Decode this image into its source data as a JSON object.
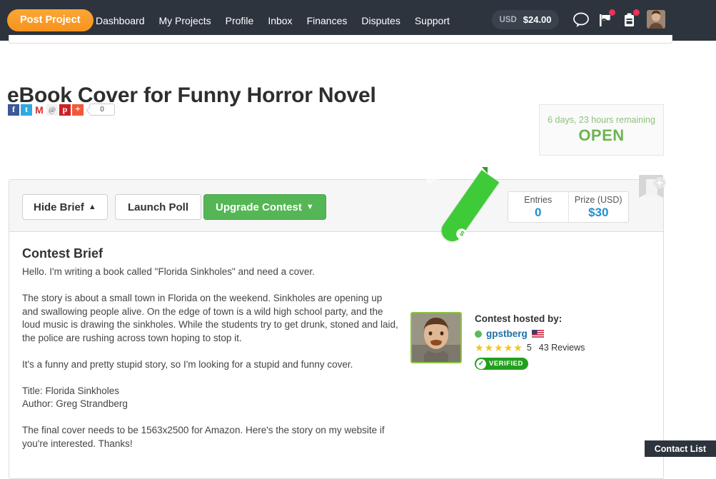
{
  "topnav": {
    "post_project_label": "Post Project",
    "links": [
      {
        "label": "Dashboard"
      },
      {
        "label": "My Projects"
      },
      {
        "label": "Profile"
      },
      {
        "label": "Inbox"
      },
      {
        "label": "Finances"
      },
      {
        "label": "Disputes"
      },
      {
        "label": "Support"
      }
    ],
    "balance": {
      "currency": "USD",
      "amount": "$24.00"
    },
    "icons": [
      {
        "name": "chat-bubble-icon",
        "badge": false
      },
      {
        "name": "flag-icon",
        "badge": true
      },
      {
        "name": "clipboard-icon",
        "badge": true
      }
    ]
  },
  "page": {
    "title": "eBook Cover for Funny Horror Novel"
  },
  "social": {
    "buttons": [
      {
        "name": "facebook-share-button",
        "glyph": "f"
      },
      {
        "name": "twitter-share-button",
        "glyph": "t"
      },
      {
        "name": "gmail-share-button",
        "glyph": "M"
      },
      {
        "name": "reddit-share-button",
        "glyph": "@"
      },
      {
        "name": "pinterest-share-button",
        "glyph": "p"
      },
      {
        "name": "more-share-button",
        "glyph": "+"
      }
    ],
    "count": "0"
  },
  "status": {
    "remaining": "6 days, 23 hours remaining",
    "state": "OPEN"
  },
  "toolbar": {
    "hide_brief_label": "Hide Brief",
    "hide_brief_caret": "▲",
    "launch_poll_label": "Launch Poll",
    "upgrade_label": "Upgrade Contest",
    "upgrade_caret": "▼",
    "ribbon_label": "Guaranteed",
    "ribbon_coin": "$",
    "stats": [
      {
        "label": "Entries",
        "value": "0"
      },
      {
        "label": "Prize (USD)",
        "value": "$30"
      }
    ]
  },
  "brief": {
    "heading": "Contest Brief",
    "body": "Hello. I'm writing a book called \"Florida Sinkholes\" and need a cover.\n\nThe story is about a small town in Florida on the weekend. Sinkholes are opening up and swallowing people alive. On the edge of town is a wild high school party, and the loud music is drawing the sinkholes. While the students try to get drunk, stoned and laid, the police are rushing across town hoping to stop it.\n\nIt's a funny and pretty stupid story, so I'm looking for a stupid and funny cover.\n\nTitle: Florida Sinkholes\nAuthor: Greg Strandberg\n\nThe final cover needs to be 1563x2500 for Amazon. Here's the story on my website if you're interested. Thanks!"
  },
  "host": {
    "hosted_by_label": "Contest hosted by:",
    "username": "gpstberg",
    "country": "United States",
    "rating": "5",
    "stars": [
      "★",
      "★",
      "★",
      "★",
      "★"
    ],
    "reviews": "43 Reviews",
    "verified_label": "VERIFIED",
    "verified_check": "✓"
  },
  "footer": {
    "contact_list_label": "Contact List"
  },
  "colors": {
    "nav_bg": "#2d343d",
    "accent_orange": "#f7931e",
    "accent_green": "#55b655",
    "ribbon_green": "#3ecb37",
    "link_blue": "#1e6fa8",
    "stat_blue": "#1e8fd0",
    "open_green": "#6cb550",
    "badge_red": "#e8345a"
  }
}
